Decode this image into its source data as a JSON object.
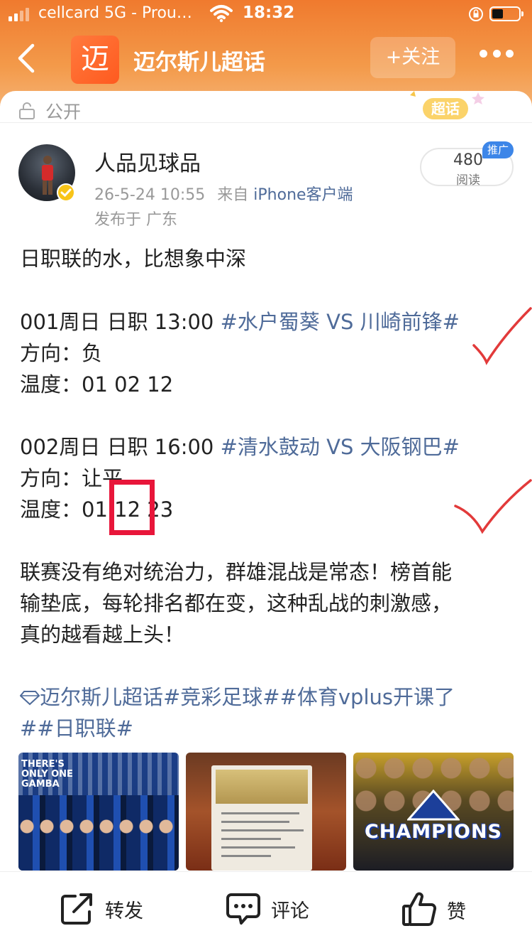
{
  "status_bar": {
    "carrier": "cellcard 5G - Prou…",
    "time": "18:32"
  },
  "nav": {
    "app_logo_char": "迈",
    "title": "迈尔斯儿超话",
    "follow_label": "+关注"
  },
  "visibility": {
    "label": "公开",
    "badge_label": "超话"
  },
  "post": {
    "author": "人品见球品",
    "time": "26-5-24 10:55",
    "source_prefix": "来自",
    "source": "iPhone客户端",
    "location": "发布于 广东",
    "reads_count": "480",
    "reads_label": "阅读",
    "promo_label": "推广",
    "intro": "日职联的水，比想象中深",
    "matches": [
      {
        "header_prefix": "001周日 日职 13:00 ",
        "topic": "#水户蜀葵 VS 川崎前锋#",
        "direction": "方向：负",
        "temperature": "温度：01 02 12"
      },
      {
        "header_prefix": "002周日 日职 16:00 ",
        "topic": "#清水鼓动 VS 大阪钢巴#",
        "direction": "方向：让平",
        "temperature": "温度：01 12 23"
      }
    ],
    "paragraph_lines": [
      "联赛没有绝对统治力，群雄混战是常态！榜首能",
      "输垫底，每轮排名都在变，这种乱战的刺激感，",
      "真的越看越上头！"
    ],
    "tags_line1": "迈尔斯儿超话#竞彩足球##体育vplus开课了",
    "tags_line2": "##日职联#",
    "images": [
      {
        "name": "gamba-team-photo",
        "banner": "THERE'S ONLY ONE GAMBA"
      },
      {
        "name": "betting-slip-photo"
      },
      {
        "name": "gamba-champions-photo",
        "caption": "CHAMPIONS"
      }
    ]
  },
  "actions": {
    "repost": "转发",
    "comment": "评论",
    "like": "赞"
  },
  "colors": {
    "header_orange": "#f07a2e",
    "link_blue": "#4f6b99",
    "highlight_red": "#e8163a",
    "verify_gold": "#f8c418",
    "promo_blue": "#3d86e8"
  }
}
